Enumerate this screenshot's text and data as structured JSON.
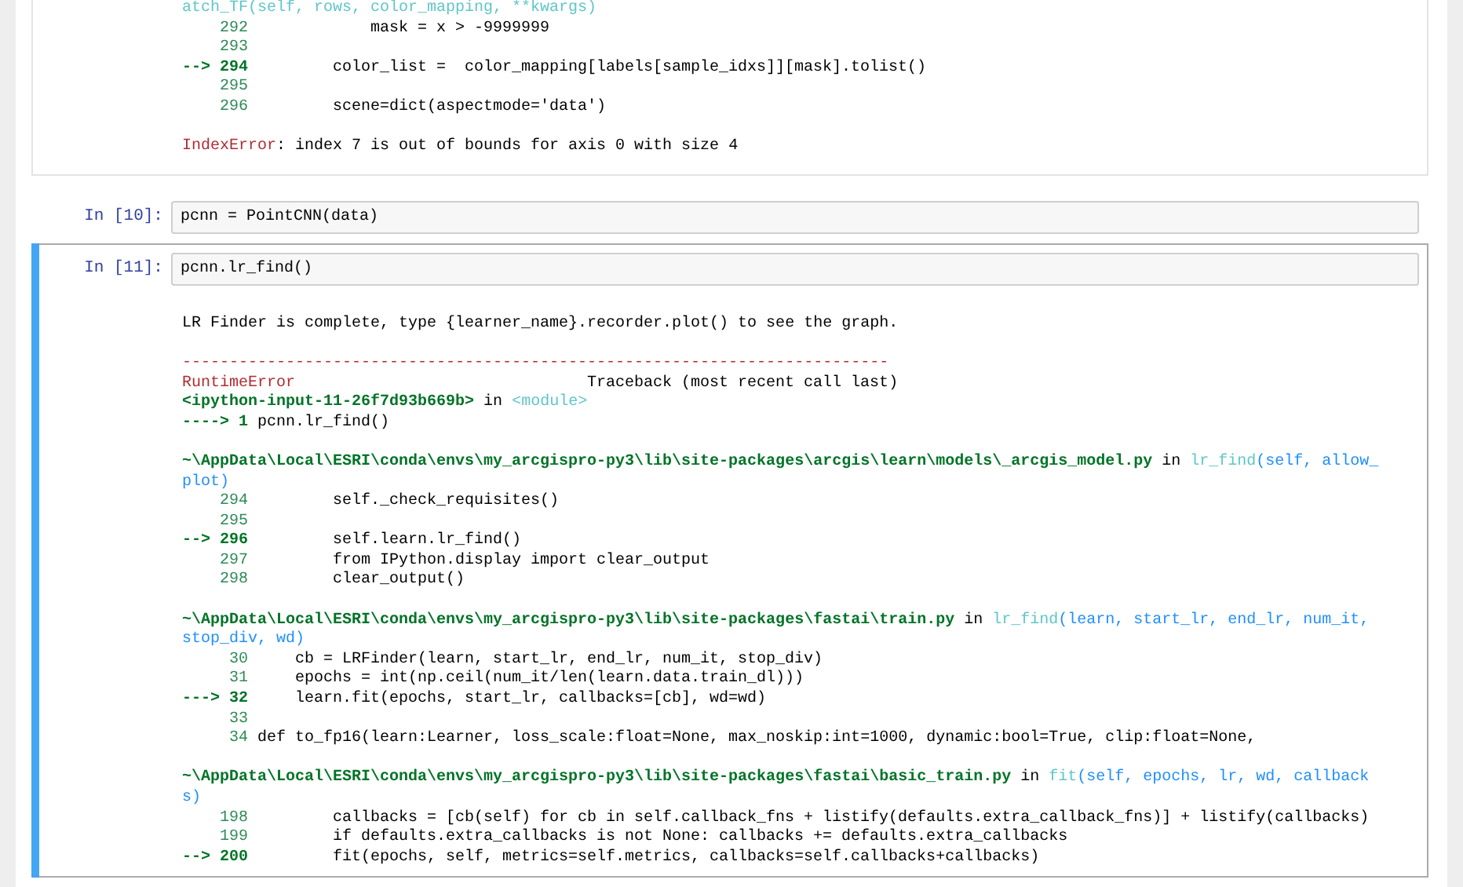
{
  "previous_output": {
    "lines": [
      {
        "kind": "continuation",
        "text": "atch_TF(self, rows, color_mapping, **kwargs)"
      },
      {
        "kind": "line",
        "number": "292",
        "code": "            mask = x > -9999999"
      },
      {
        "kind": "line",
        "number": "293"
      },
      {
        "kind": "line",
        "arrow": "-->",
        "number": "294",
        "code": "        color_list =  color_mapping[labels[sample_idxs]][mask].tolist()"
      },
      {
        "kind": "line",
        "number": "295"
      },
      {
        "kind": "line",
        "number": "296",
        "code": "        scene=dict(aspectmode='data')"
      },
      {
        "kind": "blank"
      },
      {
        "kind": "error",
        "name": "IndexError",
        "message": ": index 7 is out of bounds for axis 0 with size 4"
      }
    ]
  },
  "cells": [
    {
      "prompt": "In [10]:",
      "code": "pcnn = PointCNN(data)",
      "selected": false
    },
    {
      "prompt": "In [11]:",
      "code": "pcnn.lr_find()",
      "selected": true,
      "output": [
        {
          "kind": "stream",
          "text": "LR Finder is complete, type {learner_name}.recorder.plot() to see the graph."
        },
        {
          "kind": "blank"
        },
        {
          "kind": "rule",
          "text": "---------------------------------------------------------------------------"
        },
        {
          "kind": "error_header",
          "name": "RuntimeError",
          "label": "Traceback (most recent call last)"
        },
        {
          "kind": "frame",
          "file": "<ipython-input-11-26f7d93b669b>",
          "connector": "in",
          "func": "<module>"
        },
        {
          "kind": "line",
          "arrow": "---->",
          "number": "1",
          "code": "pcnn.lr_find()"
        },
        {
          "kind": "blank"
        },
        {
          "kind": "frame",
          "file": "~\\AppData\\Local\\ESRI\\conda\\envs\\my_arcgispro-py3\\lib\\site-packages\\arcgis\\learn\\models\\_arcgis_model.py",
          "connector": "in",
          "func": "lr_find",
          "args": "(self, allow_plot)"
        },
        {
          "kind": "line",
          "number": "294",
          "code": "        self._check_requisites()"
        },
        {
          "kind": "line",
          "number": "295"
        },
        {
          "kind": "line",
          "arrow": "-->",
          "number": "296",
          "code": "        self.learn.lr_find()"
        },
        {
          "kind": "line",
          "number": "297",
          "code": "        from IPython.display import clear_output"
        },
        {
          "kind": "line",
          "number": "298",
          "code": "        clear_output()"
        },
        {
          "kind": "blank"
        },
        {
          "kind": "frame",
          "file": "~\\AppData\\Local\\ESRI\\conda\\envs\\my_arcgispro-py3\\lib\\site-packages\\fastai\\train.py",
          "connector": "in",
          "func": "lr_find",
          "args": "(learn, start_lr, end_lr, num_it, stop_div, wd)"
        },
        {
          "kind": "line",
          "number": "30",
          "code": "    cb = LRFinder(learn, start_lr, end_lr, num_it, stop_div)"
        },
        {
          "kind": "line",
          "number": "31",
          "code": "    epochs = int(np.ceil(num_it/len(learn.data.train_dl)))"
        },
        {
          "kind": "line",
          "arrow": "--->",
          "number": "32",
          "code": "    learn.fit(epochs, start_lr, callbacks=[cb], wd=wd)"
        },
        {
          "kind": "line",
          "number": "33"
        },
        {
          "kind": "line",
          "number": "34",
          "code": "def to_fp16(learn:Learner, loss_scale:float=None, max_noskip:int=1000, dynamic:bool=True, clip:float=None,"
        },
        {
          "kind": "blank"
        },
        {
          "kind": "frame",
          "file": "~\\AppData\\Local\\ESRI\\conda\\envs\\my_arcgispro-py3\\lib\\site-packages\\fastai\\basic_train.py",
          "connector": "in",
          "func": "fit",
          "args": "(self, epochs, lr, wd, callbacks)"
        },
        {
          "kind": "line",
          "number": "198",
          "code": "        callbacks = [cb(self) for cb in self.callback_fns + listify(defaults.extra_callback_fns)] + listify(callbacks)"
        },
        {
          "kind": "line",
          "number": "199",
          "code": "        if defaults.extra_callbacks is not None: callbacks += defaults.extra_callbacks"
        },
        {
          "kind": "line",
          "arrow": "-->",
          "number": "200",
          "code": "        fit(epochs, self, metrics=self.metrics, callbacks=self.callbacks+callbacks)"
        }
      ]
    }
  ]
}
